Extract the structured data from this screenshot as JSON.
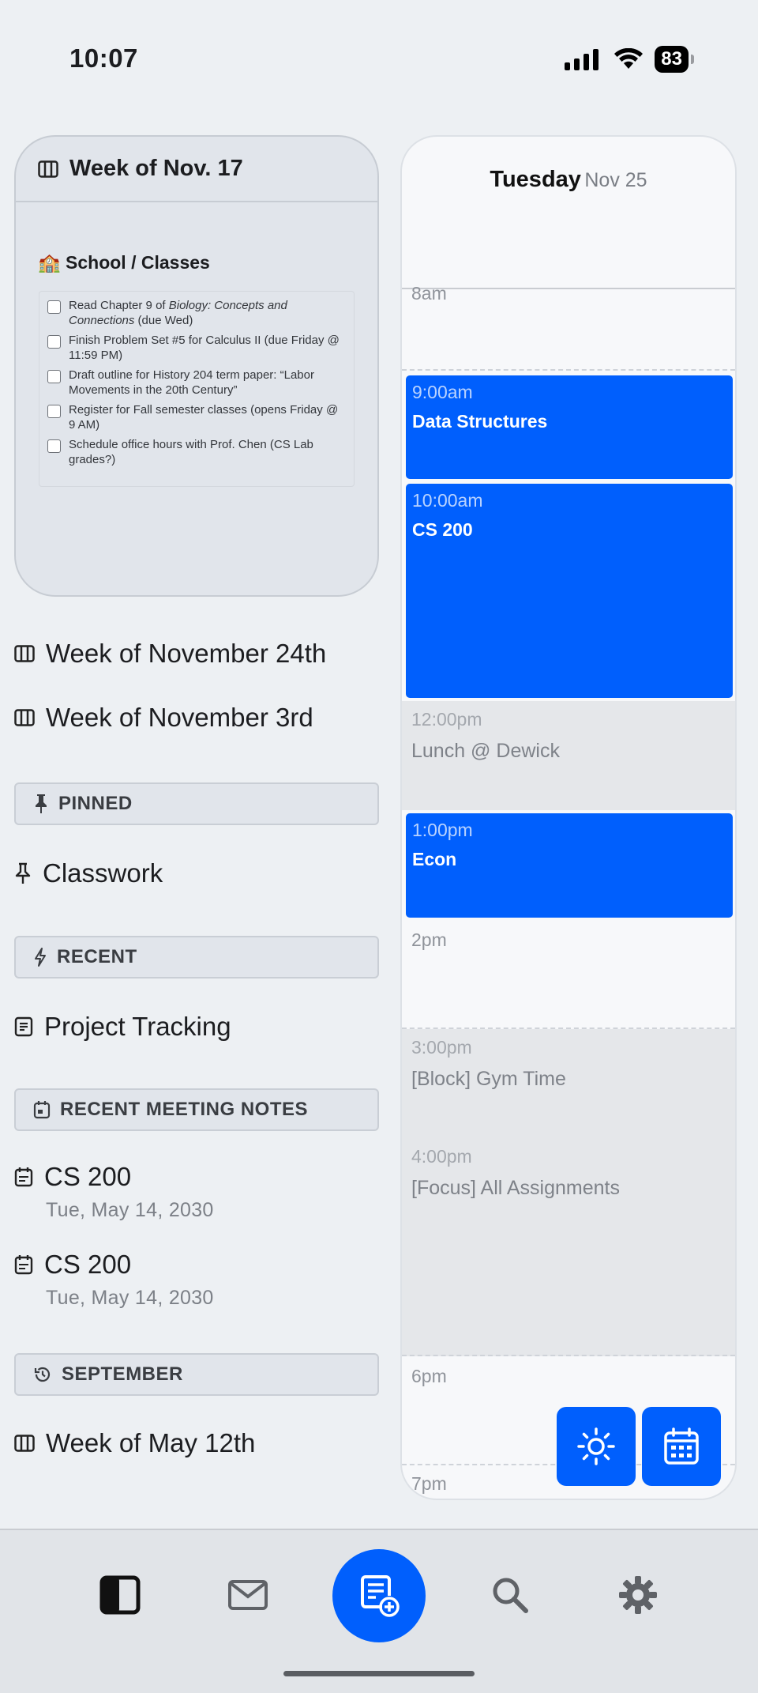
{
  "status_bar": {
    "time": "10:07",
    "battery": "83"
  },
  "current_week": {
    "title": "Week of Nov. 17",
    "section_title": "🏫 School / Classes",
    "tasks": [
      {
        "text_plain": "Read Chapter 9 of ",
        "text_italic": "Biology: Concepts and Connections",
        "text_after": " (due Wed)"
      },
      {
        "text_plain": "Finish Problem Set #5 for Calculus II (due Friday @ 11:59 PM)"
      },
      {
        "text_plain": "Draft outline for History 204 term paper: “Labor Movements in the 20th Century”"
      },
      {
        "text_plain": "Register for Fall semester classes (opens Friday @ 9 AM)"
      },
      {
        "text_plain": "Schedule office hours with Prof. Chen (CS Lab grades?)"
      }
    ]
  },
  "weeks": [
    {
      "label": "Week of November 24th"
    },
    {
      "label": "Week of November 3rd"
    }
  ],
  "pinned": {
    "header": "PINNED",
    "items": [
      {
        "label": "Classwork"
      }
    ]
  },
  "recent": {
    "header": "RECENT",
    "items": [
      {
        "label": "Project Tracking"
      }
    ]
  },
  "meetings": {
    "header": "RECENT MEETING NOTES",
    "items": [
      {
        "title": "CS 200",
        "date": "Tue, May 14, 2030"
      },
      {
        "title": "CS 200",
        "date": "Tue, May 14, 2030"
      }
    ]
  },
  "september": {
    "header": "SEPTEMBER",
    "items": [
      {
        "label": "Week of May 12th"
      }
    ]
  },
  "calendar": {
    "day": "Tuesday",
    "date": "Nov 25",
    "hour_labels": {
      "h8": "8am",
      "h2": "2pm",
      "h6": "6pm",
      "h7": "7pm"
    },
    "events": [
      {
        "time": "9:00am",
        "title": "Data Structures"
      },
      {
        "time": "10:00am",
        "title": "CS 200"
      },
      {
        "time": "1:00pm",
        "title": "Econ"
      }
    ],
    "blocks": [
      {
        "time": "12:00pm",
        "title": "Lunch @ Dewick"
      },
      {
        "time": "3:00pm",
        "title": "[Block] Gym Time"
      },
      {
        "time": "4:00pm",
        "title": "[Focus] All Assignments"
      }
    ]
  },
  "colors": {
    "accent": "#005ffd",
    "background": "#edf0f3",
    "panel": "#e1e5eb"
  }
}
